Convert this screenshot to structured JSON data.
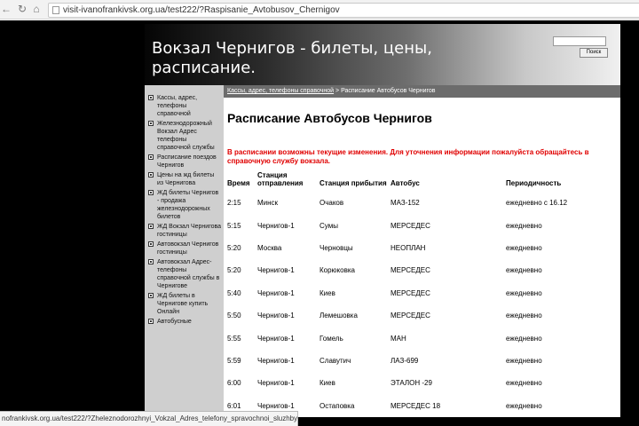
{
  "browser": {
    "url": "visit-ivanofrankivsk.org.ua/test222/?Raspisanie_Avtobusov_Chernigov",
    "status_url": "nofrankivsk.org.ua/test222/?Zheleznodorozhnyi_Vokzal_Adres_telefony_spravochnoi_sluzhby"
  },
  "header": {
    "title": "Вокзал Чернигов - билеты, цены, расписание.",
    "search_button": "Поиск",
    "search_value": ""
  },
  "breadcrumb": {
    "link": "Кассы, адрес, телефоны справочной",
    "separator": " > ",
    "current": "Расписание Автобусов Чернигов"
  },
  "sidebar": {
    "items": [
      {
        "label": "Кассы, адрес, телефоны справочной"
      },
      {
        "label": "Железнодорожный Вокзал Адрес телефоны справочной службы"
      },
      {
        "label": "Расписание поездов Чернигов"
      },
      {
        "label": "Цены на жд билеты из Чернигова"
      },
      {
        "label": "ЖД билеты Чернигов - продажа железнодорожных билетов"
      },
      {
        "label": "ЖД Вокзал Чернигова гостиницы"
      },
      {
        "label": "Автовокзал Чернигов гостиницы"
      },
      {
        "label": "Автовокзал Адрес-телефоны справочной службы в Чернигове"
      },
      {
        "label": "ЖД билеты в Чернигове купить Онлайн"
      },
      {
        "label": "Автобусные"
      }
    ]
  },
  "main": {
    "title": "Расписание Автобусов Чернигов",
    "notice": "В расписании возможны текущие изменения. Для уточнения информации пожалуйста обращайтесь в справочную службу вокзала.",
    "columns": [
      "Время",
      "Станция отправления",
      "Станция прибытия",
      "Автобус",
      "Периодичность"
    ],
    "rows": [
      [
        "2:15",
        "Минск",
        "Очаков",
        "МАЗ-152",
        "ежедневно с 16.12"
      ],
      [
        "5:15",
        "Чернигов-1",
        "Сумы",
        "МЕРСЕДЕС",
        "ежедневно"
      ],
      [
        "5:20",
        "Москва",
        "Черновцы",
        "НЕОПЛАН",
        "ежедневно"
      ],
      [
        "5:20",
        "Чернигов-1",
        "Корюковка",
        "МЕРСЕДЕС",
        "ежедневно"
      ],
      [
        "5:40",
        "Чернигов-1",
        "Киев",
        "МЕРСЕДЕС",
        "ежедневно"
      ],
      [
        "5:50",
        "Чернигов-1",
        "Лемешовка",
        "МЕРСЕДЕС",
        "ежедневно"
      ],
      [
        "5:55",
        "Чернигов-1",
        "Гомель",
        "МАН",
        "ежедневно"
      ],
      [
        "5:59",
        "Чернигов-1",
        "Славутич",
        "ЛАЗ-699",
        "ежедневно"
      ],
      [
        "6:00",
        "Чернигов-1",
        "Киев",
        "ЭТАЛОН -29",
        "ежедневно"
      ],
      [
        "6:01",
        "Чернигов-1",
        "Остаповка",
        "МЕРСЕДЕС 18",
        "ежедневно"
      ]
    ]
  }
}
